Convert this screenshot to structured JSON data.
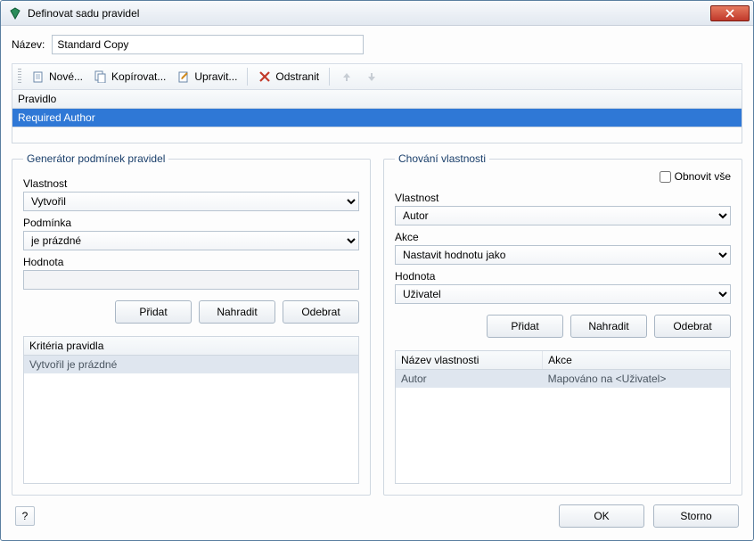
{
  "window": {
    "title": "Definovat sadu pravidel"
  },
  "name_row": {
    "label": "Název:",
    "value": "Standard Copy"
  },
  "toolbar": {
    "new": "Nové...",
    "copy": "Kopírovat...",
    "edit": "Upravit...",
    "delete": "Odstranit"
  },
  "rule_list": {
    "header": "Pravidlo",
    "selected": "Required Author"
  },
  "generator": {
    "legend": "Generátor podmínek pravidel",
    "property_label": "Vlastnost",
    "property_value": "Vytvořil",
    "condition_label": "Podmínka",
    "condition_value": "je prázdné",
    "value_label": "Hodnota",
    "value_value": "",
    "add": "Přidat",
    "replace": "Nahradit",
    "remove": "Odebrat",
    "criteria_header": "Kritéria pravidla",
    "criteria_row": "Vytvořil je prázdné"
  },
  "behavior": {
    "legend": "Chování vlastnosti",
    "reset_all": "Obnovit vše",
    "property_label": "Vlastnost",
    "property_value": "Autor",
    "action_label": "Akce",
    "action_value": "Nastavit hodnotu jako",
    "value_label": "Hodnota",
    "value_value": "Uživatel",
    "add": "Přidat",
    "replace": "Nahradit",
    "remove": "Odebrat",
    "table_header_name": "Název vlastnosti",
    "table_header_action": "Akce",
    "row_name": "Autor",
    "row_action": "Mapováno na <Uživatel>"
  },
  "footer": {
    "help": "?",
    "ok": "OK",
    "cancel": "Storno"
  }
}
